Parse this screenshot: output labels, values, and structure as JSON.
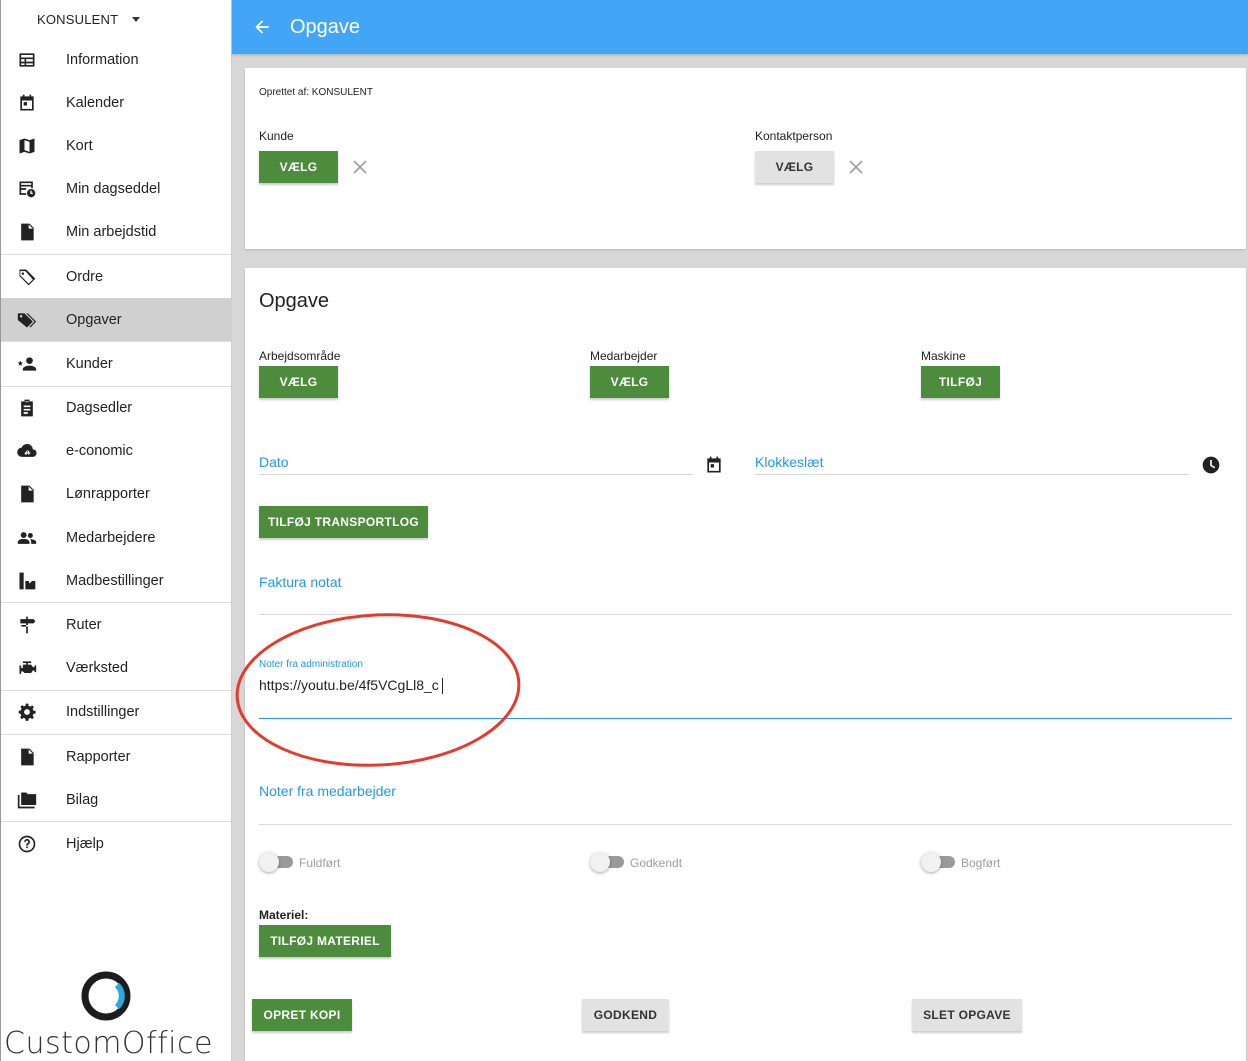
{
  "sidebar": {
    "user_label": "KONSULENT",
    "items": [
      {
        "label": "Information",
        "icon": "table-icon"
      },
      {
        "label": "Kalender",
        "icon": "calendar-icon"
      },
      {
        "label": "Kort",
        "icon": "map-icon"
      },
      {
        "label": "Min dagseddel",
        "icon": "timesheet-icon"
      },
      {
        "label": "Min arbejdstid",
        "icon": "document-icon"
      },
      {
        "label": "Ordre",
        "icon": "tag-icon"
      },
      {
        "label": "Opgaver",
        "icon": "tags-icon"
      },
      {
        "label": "Kunder",
        "icon": "star-person-icon"
      },
      {
        "label": "Dagsedler",
        "icon": "clipboard-icon"
      },
      {
        "label": "e-conomic",
        "icon": "cloud-sync-icon"
      },
      {
        "label": "Lønrapporter",
        "icon": "document-icon"
      },
      {
        "label": "Medarbejdere",
        "icon": "people-icon"
      },
      {
        "label": "Madbestillinger",
        "icon": "food-icon"
      },
      {
        "label": "Ruter",
        "icon": "signpost-icon"
      },
      {
        "label": "Værksted",
        "icon": "engine-icon"
      },
      {
        "label": "Indstillinger",
        "icon": "gear-icon"
      },
      {
        "label": "Rapporter",
        "icon": "report-icon"
      },
      {
        "label": "Bilag",
        "icon": "folder-icon"
      },
      {
        "label": "Hjælp",
        "icon": "help-icon"
      }
    ],
    "active_item": "Opgaver",
    "logo_text": "CustomOffice"
  },
  "header": {
    "title": "Opgave"
  },
  "card1": {
    "created_by": "Oprettet af: KONSULENT",
    "kunde_label": "Kunde",
    "kunde_button": "VÆLG",
    "kontakt_label": "Kontaktperson",
    "kontakt_button": "VÆLG"
  },
  "card2": {
    "title": "Opgave",
    "arbejdsomraade_label": "Arbejdsområde",
    "arbejdsomraade_button": "VÆLG",
    "medarbejder_label": "Medarbejder",
    "medarbejder_button": "VÆLG",
    "maskine_label": "Maskine",
    "maskine_button": "TILFØJ",
    "dato_label": "Dato",
    "klokkeslaet_label": "Klokkeslæt",
    "transportlog_button": "TILFØJ TRANSPORTLOG",
    "faktura_label": "Faktura notat",
    "admin_notes_label": "Noter fra administration",
    "admin_notes_value": "https://youtu.be/4f5VCgLl8_c",
    "employee_notes_label": "Noter fra medarbejder",
    "toggles": [
      {
        "label": "Fuldført",
        "on": false
      },
      {
        "label": "Godkendt",
        "on": false
      },
      {
        "label": "Bogført",
        "on": false
      }
    ],
    "materiel_label": "Materiel:",
    "materiel_button": "TILFØJ MATERIEL",
    "copy_button": "OPRET KOPI",
    "approve_button": "GODKEND",
    "delete_button": "SLET OPGAVE"
  },
  "colors": {
    "header": "#42a5f5",
    "primary_button": "#4c8c3c",
    "link": "#2196f3",
    "annotation_circle": "#e53b2c"
  }
}
